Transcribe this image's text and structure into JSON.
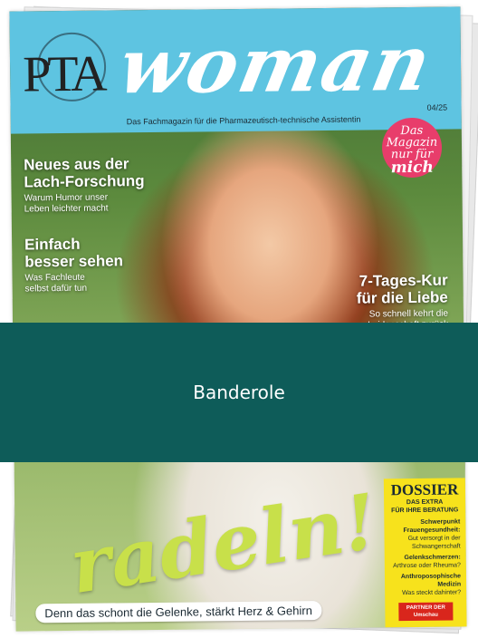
{
  "magazine": {
    "logo": "PTA",
    "title": "woman",
    "issue": "04/25",
    "tagline": "Das Fachmagazin für die Pharmazeutisch-technische Assistentin",
    "badge": {
      "line1": "Das",
      "line2": "Magazin",
      "line3": "nur für",
      "line4": "mich"
    }
  },
  "headlines": [
    {
      "title_1": "Neues aus der",
      "title_2": "Lach-Forschung",
      "sub_1": "Warum Humor unser",
      "sub_2": "Leben leichter macht"
    },
    {
      "title_1": "Einfach",
      "title_2": "besser sehen",
      "sub_1": "Was Fachleute",
      "sub_2": "selbst dafür tun"
    },
    {
      "title_1": "7-Tages-Kur",
      "title_2": "für die Liebe",
      "sub_1": "So schnell kehrt die",
      "sub_2": "Leidenschaft zurück"
    }
  ],
  "cover_script": "radeln!",
  "cover_caption": "Denn das schont die Gelenke, stärkt Herz & Gehirn",
  "dossier": {
    "title": "DOSSIER",
    "subtitle_1": "DAS EXTRA",
    "subtitle_2": "FÜR IHRE BERATUNG",
    "items": [
      {
        "head": "Schwerpunkt Frauengesundheit:",
        "text": "Gut versorgt in der Schwangerschaft"
      },
      {
        "head": "Gelenkschmerzen:",
        "text": "Arthrose oder Rheuma?"
      },
      {
        "head": "Anthroposophische Medizin",
        "text": "Was steckt dahinter?"
      }
    ],
    "partner_label": "PARTNER DER",
    "partner_name": "Umschau"
  },
  "banderole": {
    "label": "Banderole"
  },
  "colors": {
    "masthead": "#5ec4e1",
    "banderole": "#0e5c59",
    "badge": "#e83d6b",
    "dossier": "#f7e21c",
    "script": "#c8e04a"
  }
}
